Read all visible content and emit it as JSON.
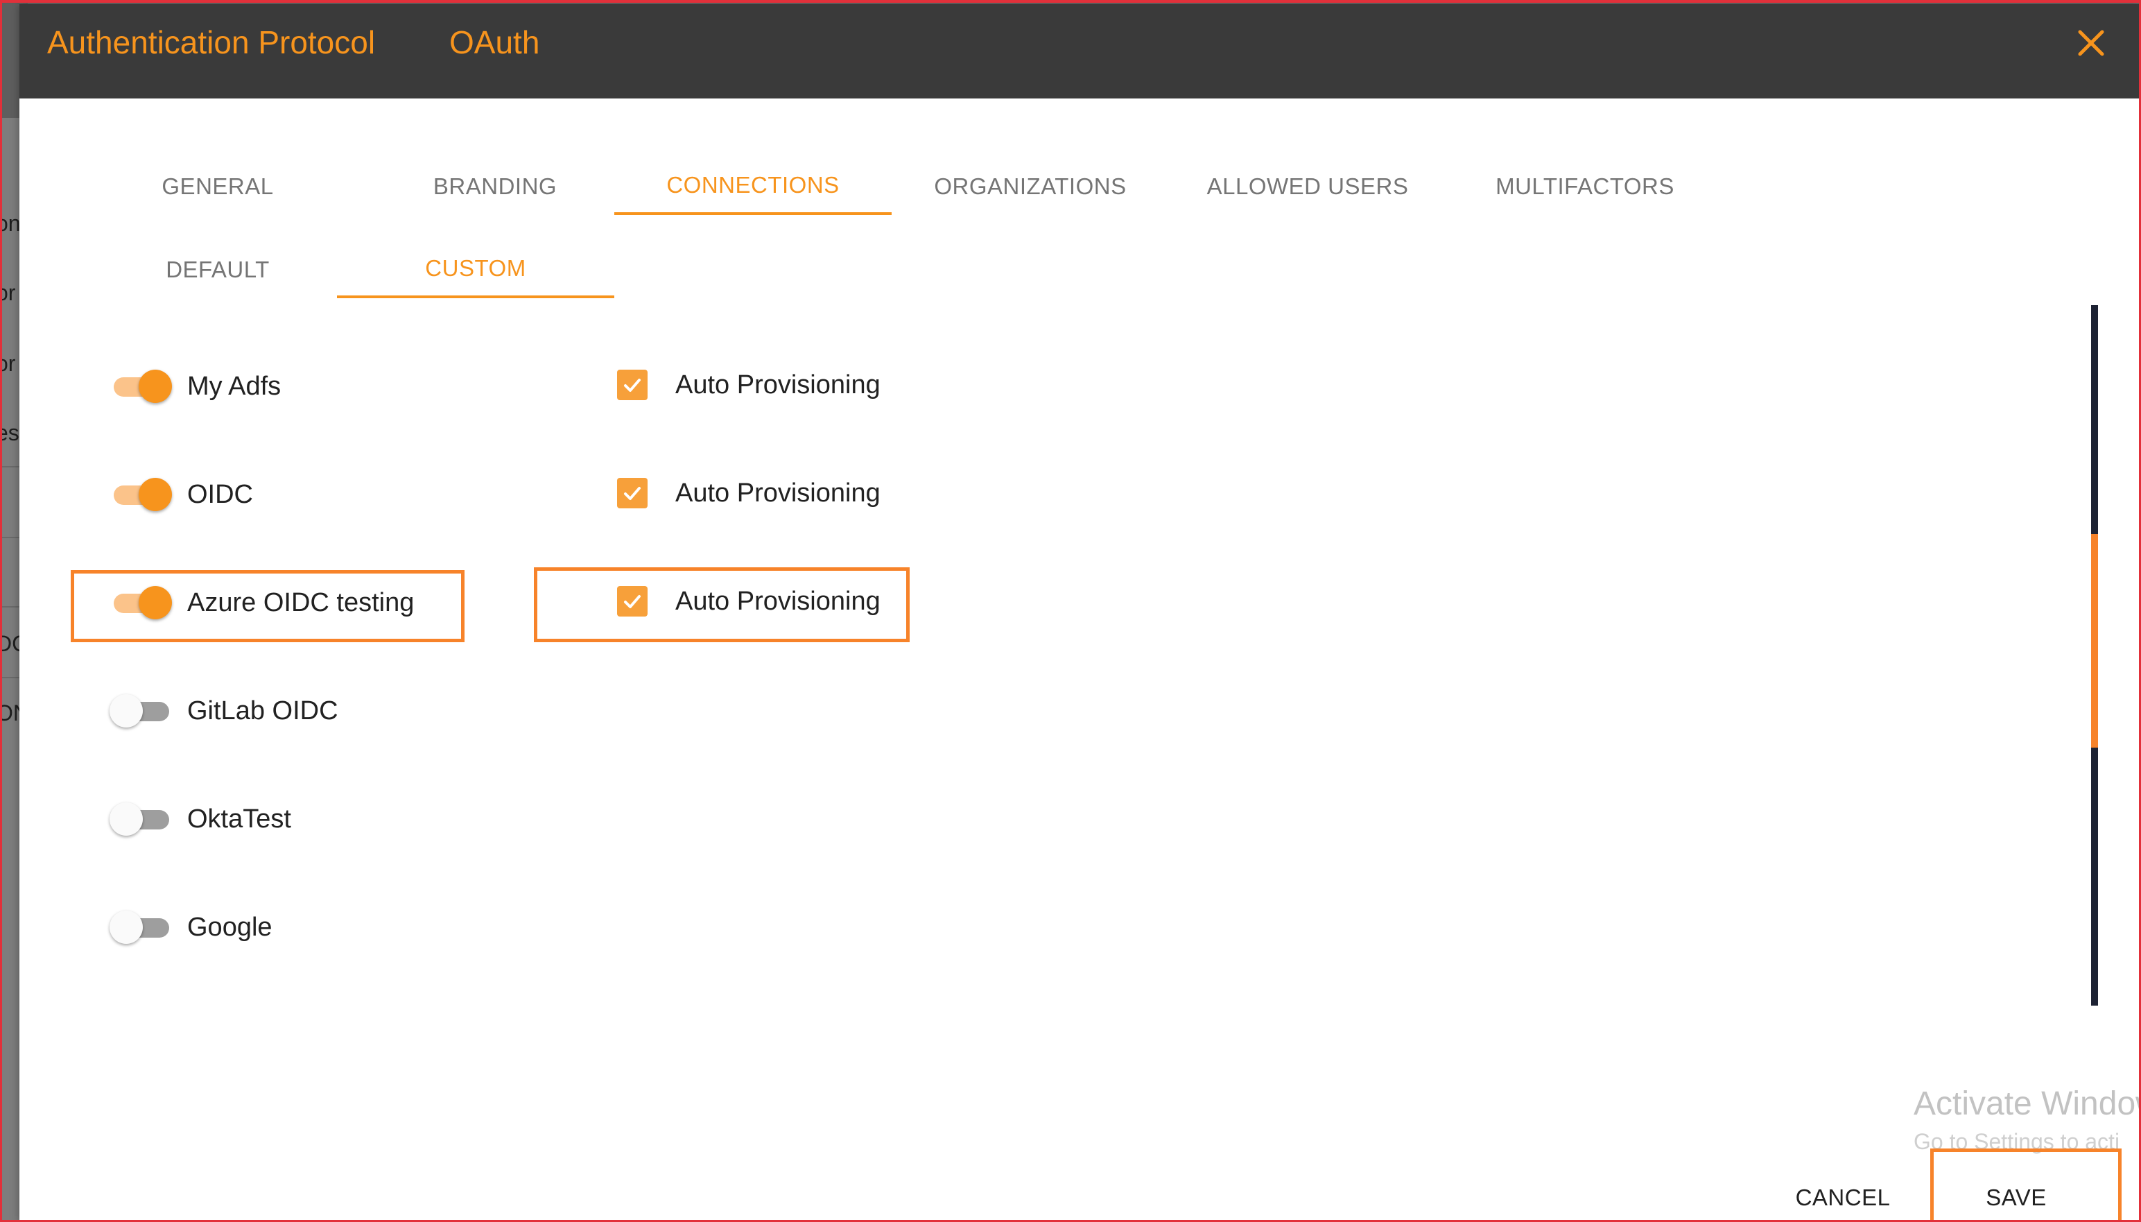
{
  "background": {
    "fragments": [
      "on",
      "or",
      "or",
      "es",
      "DC",
      "ON"
    ]
  },
  "dialog": {
    "title": "Authentication Protocol",
    "subtitle": "OAuth",
    "close_icon": "close-icon"
  },
  "tabs": {
    "primary": [
      {
        "label": "GENERAL",
        "active": false
      },
      {
        "label": "BRANDING",
        "active": false
      },
      {
        "label": "CONNECTIONS",
        "active": true
      },
      {
        "label": "ORGANIZATIONS",
        "active": false
      },
      {
        "label": "ALLOWED USERS",
        "active": false
      },
      {
        "label": "MULTIFACTORS",
        "active": false
      }
    ],
    "secondary": [
      {
        "label": "DEFAULT",
        "active": false
      },
      {
        "label": "CUSTOM",
        "active": true
      }
    ]
  },
  "connections": [
    {
      "name": "My Adfs",
      "enabled": true,
      "auto_provisioning": {
        "label": "Auto Provisioning",
        "checked": true
      }
    },
    {
      "name": "OIDC",
      "enabled": true,
      "auto_provisioning": {
        "label": "Auto Provisioning",
        "checked": true
      }
    },
    {
      "name": "Azure OIDC testing",
      "enabled": true,
      "auto_provisioning": {
        "label": "Auto Provisioning",
        "checked": true
      }
    },
    {
      "name": "GitLab OIDC",
      "enabled": false
    },
    {
      "name": "OktaTest",
      "enabled": false
    },
    {
      "name": "Google",
      "enabled": false
    }
  ],
  "watermark": {
    "title": "Activate Window",
    "subtitle": "Go to Settings to acti"
  },
  "footer": {
    "cancel_label": "CANCEL",
    "save_label": "SAVE"
  },
  "colors": {
    "accent": "#f7941d",
    "header_bg": "#3a3a3a",
    "highlight": "#f7832a",
    "toggle_track_on": "#fbc38a",
    "checkbox": "#f7a03a"
  }
}
